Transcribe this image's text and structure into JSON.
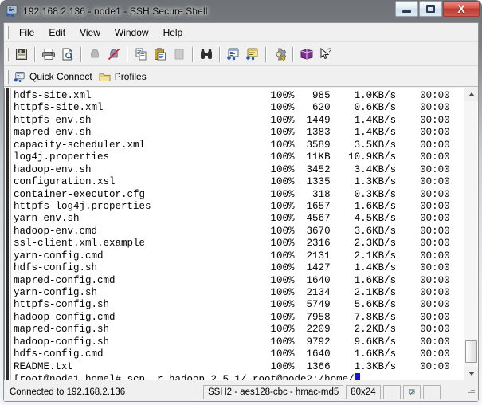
{
  "window": {
    "title": "192.168.2.136 - node1 - SSH Secure Shell",
    "title_icon": "ssh-app-icon",
    "minimize_label": "–",
    "maximize_label": "□",
    "close_label": "X"
  },
  "menu": [
    {
      "name": "file",
      "accel": "F",
      "rest": "ile"
    },
    {
      "name": "edit",
      "accel": "E",
      "rest": "dit"
    },
    {
      "name": "view",
      "accel": "V",
      "rest": "iew"
    },
    {
      "name": "window",
      "accel": "W",
      "rest": "indow"
    },
    {
      "name": "help",
      "accel": "H",
      "rest": "elp"
    }
  ],
  "toolbar": {
    "buttons": [
      {
        "name": "save-button",
        "icon": "floppy-disk-icon",
        "enabled": true
      },
      {
        "name": "print-button",
        "icon": "printer-icon",
        "enabled": true
      },
      {
        "name": "print-preview-button",
        "icon": "print-preview-icon",
        "enabled": true
      },
      {
        "name": "connect-button",
        "icon": "connect-plug-icon",
        "enabled": false
      },
      {
        "name": "disconnect-button",
        "icon": "disconnect-icon",
        "enabled": true
      },
      {
        "name": "copy-button",
        "icon": "copy-icon",
        "enabled": true
      },
      {
        "name": "paste-button",
        "icon": "paste-clipboard-icon",
        "enabled": true
      },
      {
        "name": "clear-button",
        "icon": "blank-page-icon",
        "enabled": false
      },
      {
        "name": "find-button",
        "icon": "binoculars-icon",
        "enabled": true
      },
      {
        "name": "new-terminal-button",
        "icon": "terminal-window-icon",
        "enabled": true
      },
      {
        "name": "file-transfer-button",
        "icon": "file-transfer-icon",
        "enabled": true
      },
      {
        "name": "settings-button",
        "icon": "gear-settings-icon",
        "enabled": true
      },
      {
        "name": "help-book-button",
        "icon": "help-book-icon",
        "enabled": true
      },
      {
        "name": "whats-this-button",
        "icon": "arrow-question-icon",
        "enabled": true
      }
    ]
  },
  "quickbar": {
    "quick_connect": "Quick Connect",
    "quick_connect_icon": "quick-connect-icon",
    "profiles": "Profiles",
    "profiles_icon": "folder-profiles-icon"
  },
  "terminal": {
    "rows": [
      {
        "file": "hdfs-site.xml",
        "pct": "100%",
        "size": "985",
        "rate": "1.0KB/s",
        "time": "00:00"
      },
      {
        "file": "httpfs-site.xml",
        "pct": "100%",
        "size": "620",
        "rate": "0.6KB/s",
        "time": "00:00"
      },
      {
        "file": "httpfs-env.sh",
        "pct": "100%",
        "size": "1449",
        "rate": "1.4KB/s",
        "time": "00:00"
      },
      {
        "file": "mapred-env.sh",
        "pct": "100%",
        "size": "1383",
        "rate": "1.4KB/s",
        "time": "00:00"
      },
      {
        "file": "capacity-scheduler.xml",
        "pct": "100%",
        "size": "3589",
        "rate": "3.5KB/s",
        "time": "00:00"
      },
      {
        "file": "log4j.properties",
        "pct": "100%",
        "size": "11KB",
        "rate": "10.9KB/s",
        "time": "00:00"
      },
      {
        "file": "hadoop-env.sh",
        "pct": "100%",
        "size": "3452",
        "rate": "3.4KB/s",
        "time": "00:00"
      },
      {
        "file": "configuration.xsl",
        "pct": "100%",
        "size": "1335",
        "rate": "1.3KB/s",
        "time": "00:00"
      },
      {
        "file": "container-executor.cfg",
        "pct": "100%",
        "size": "318",
        "rate": "0.3KB/s",
        "time": "00:00"
      },
      {
        "file": "httpfs-log4j.properties",
        "pct": "100%",
        "size": "1657",
        "rate": "1.6KB/s",
        "time": "00:00"
      },
      {
        "file": "yarn-env.sh",
        "pct": "100%",
        "size": "4567",
        "rate": "4.5KB/s",
        "time": "00:00"
      },
      {
        "file": "hadoop-env.cmd",
        "pct": "100%",
        "size": "3670",
        "rate": "3.6KB/s",
        "time": "00:00"
      },
      {
        "file": "ssl-client.xml.example",
        "pct": "100%",
        "size": "2316",
        "rate": "2.3KB/s",
        "time": "00:00"
      },
      {
        "file": "yarn-config.cmd",
        "pct": "100%",
        "size": "2131",
        "rate": "2.1KB/s",
        "time": "00:00"
      },
      {
        "file": "hdfs-config.sh",
        "pct": "100%",
        "size": "1427",
        "rate": "1.4KB/s",
        "time": "00:00"
      },
      {
        "file": "mapred-config.cmd",
        "pct": "100%",
        "size": "1640",
        "rate": "1.6KB/s",
        "time": "00:00"
      },
      {
        "file": "yarn-config.sh",
        "pct": "100%",
        "size": "2134",
        "rate": "2.1KB/s",
        "time": "00:00"
      },
      {
        "file": "httpfs-config.sh",
        "pct": "100%",
        "size": "5749",
        "rate": "5.6KB/s",
        "time": "00:00"
      },
      {
        "file": "hadoop-config.cmd",
        "pct": "100%",
        "size": "7958",
        "rate": "7.8KB/s",
        "time": "00:00"
      },
      {
        "file": "mapred-config.sh",
        "pct": "100%",
        "size": "2209",
        "rate": "2.2KB/s",
        "time": "00:00"
      },
      {
        "file": "hadoop-config.sh",
        "pct": "100%",
        "size": "9792",
        "rate": "9.6KB/s",
        "time": "00:00"
      },
      {
        "file": "hdfs-config.cmd",
        "pct": "100%",
        "size": "1640",
        "rate": "1.6KB/s",
        "time": "00:00"
      },
      {
        "file": "README.txt",
        "pct": "100%",
        "size": "1366",
        "rate": "1.3KB/s",
        "time": "00:00"
      }
    ],
    "prompt_line": "[root@node1 home]# scp -r hadoop-2.5.1/ root@node2:/home/",
    "cursor_visible": true
  },
  "scrollbar": {
    "up_icon": "scroll-up-arrow-icon",
    "down_icon": "scroll-down-arrow-icon",
    "thumb_name": "scroll-thumb"
  },
  "statusbar": {
    "connection": "Connected to 192.168.2.136",
    "cipher": "SSH2 - aes128-cbc - hmac-md5",
    "size": "80x24",
    "transfer_icon": "transfer-status-icon"
  }
}
